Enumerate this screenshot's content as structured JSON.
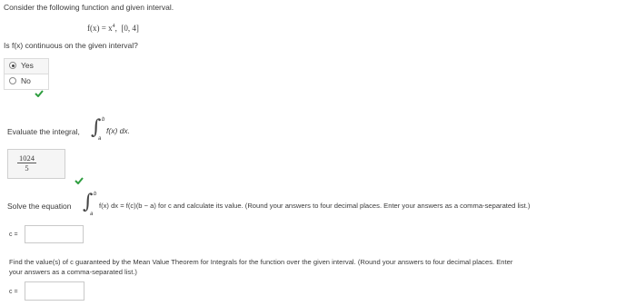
{
  "intro": "Consider the following function and given interval.",
  "function": {
    "lhs": "f(x) = x",
    "exp": "4",
    "interval": "[0, 4]"
  },
  "q1": {
    "question": "Is f(x) continuous on the given interval?",
    "options": [
      {
        "label": "Yes",
        "selected": true
      },
      {
        "label": "No",
        "selected": false
      }
    ]
  },
  "q2": {
    "prefix": "Evaluate the integral,",
    "upper": "b",
    "lower": "a",
    "integrand": "f(x) dx.",
    "answer_num": "1024",
    "answer_den": "5"
  },
  "q3": {
    "prefix": "Solve the equation",
    "upper": "b",
    "lower": "a",
    "rest": "f(x) dx = f(c)(b − a) for c and calculate its value. (Round your answers to four decimal places. Enter your answers as a comma-separated list.)",
    "c_label": "c =",
    "c_value": ""
  },
  "q4": {
    "line1": "Find the value(s) of c guaranteed by the Mean Value Theorem for Integrals for the function over the given interval. (Round your answers to four decimal places. Enter",
    "line2": "your answers as a comma-separated list.)",
    "c_label": "c =",
    "c_value": ""
  },
  "colors": {
    "check": "#2e9e3f",
    "text": "#3a3a3a"
  }
}
